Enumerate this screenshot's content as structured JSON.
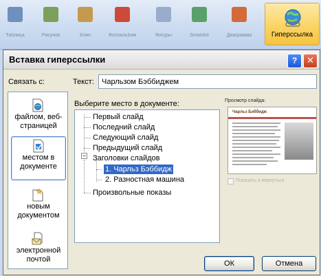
{
  "ribbon": {
    "items": [
      {
        "label": "Таблица",
        "color": "#6f8fbf"
      },
      {
        "label": "Рисунок",
        "color": "#7c9f5a"
      },
      {
        "label": "Клип",
        "color": "#c59a4f"
      },
      {
        "label": "Фотоальбом",
        "color": "#cc4a3a"
      },
      {
        "label": "Фигуры",
        "color": "#9aaccc"
      },
      {
        "label": "SmartArt",
        "color": "#5aa06a"
      },
      {
        "label": "Диаграмма",
        "color": "#d46a3a"
      }
    ],
    "hyperlink_label": "Гиперссылка"
  },
  "dialog": {
    "title": "Вставка гиперссылки",
    "help_glyph": "?",
    "close_glyph": "✕",
    "link_to_label": "Связать с:",
    "text_label": "Текст:",
    "text_value": "Чарльзом Бэббиджем",
    "place_label": "Выберите место в документе:",
    "nav": [
      {
        "label": "файлом, веб-страницей",
        "icon": "file-web-icon"
      },
      {
        "label": "местом в документе",
        "icon": "place-in-document-icon"
      },
      {
        "label": "новым документом",
        "icon": "new-document-icon"
      },
      {
        "label": "электронной почтой",
        "icon": "email-icon"
      }
    ],
    "tree": {
      "first": "Первый слайд",
      "last": "Последний слайд",
      "next": "Следующий слайд",
      "prev": "Предыдущий слайд",
      "titles": "Заголовки слайдов",
      "slide1": "1. Чарльз Бэббидж",
      "slide2": "2. Разностная машина",
      "custom": "Произвольные показы"
    },
    "preview_label": "Просмотр слайда:",
    "preview_slide_title": "Чарльз Бэббидж",
    "show_return_label": "Показать и вернуться",
    "ok_label": "ОК",
    "cancel_label": "Отмена"
  }
}
